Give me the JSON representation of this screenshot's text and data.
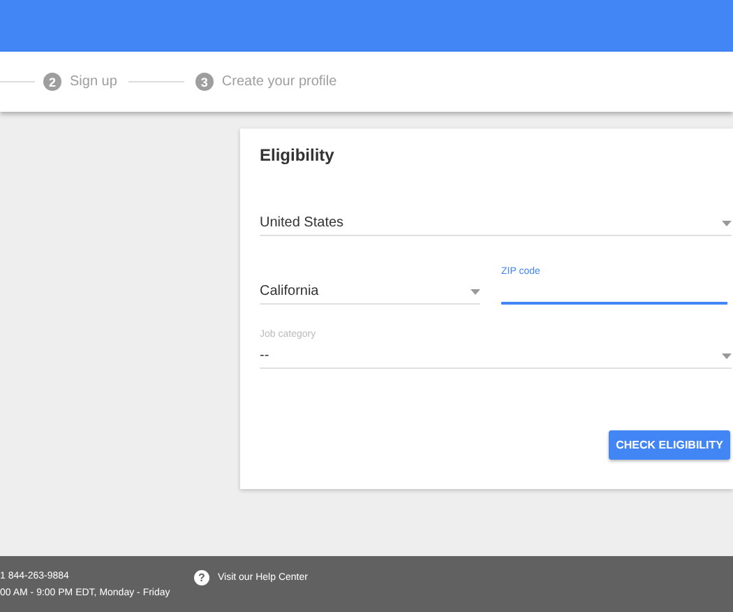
{
  "steps": [
    {
      "number": "2",
      "label": "Sign up"
    },
    {
      "number": "3",
      "label": "Create your profile"
    }
  ],
  "card": {
    "title": "Eligibility",
    "country": {
      "value": "United States"
    },
    "state": {
      "value": "California"
    },
    "zip": {
      "label": "ZIP code"
    },
    "job": {
      "label": "Job category",
      "value": "--"
    },
    "button": "CHECK ELIGIBILITY"
  },
  "footer": {
    "phone": "1 844-263-9884",
    "hours": "00 AM - 9:00 PM EDT, Monday - Friday",
    "help": "Visit our Help Center",
    "help_icon": "?"
  }
}
